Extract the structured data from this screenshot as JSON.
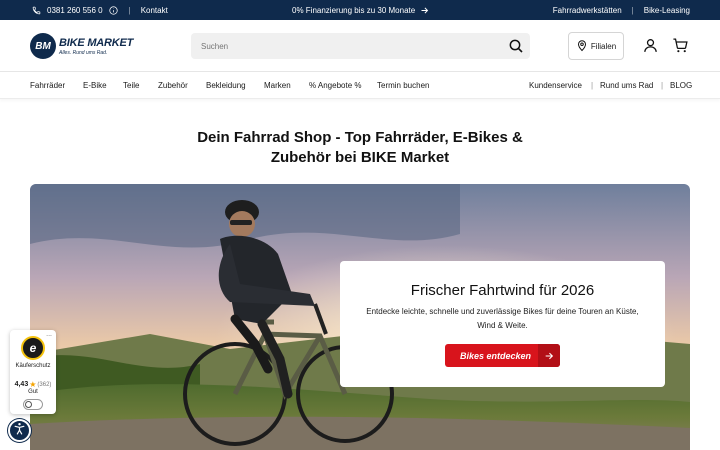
{
  "topbar": {
    "phone": "0381 260 556 0",
    "contact": "Kontakt",
    "financing": "0% Finanzierung bis zu 30 Monate",
    "workshops": "Fahrradwerkstätten",
    "leasing": "Bike-Leasing"
  },
  "header": {
    "logo_badge": "BM",
    "logo_name": "BIKE MARKET",
    "logo_tagline": "Alles. Rund ums Rad.",
    "search_placeholder": "Suchen",
    "stores_label": "Filialen"
  },
  "nav": {
    "items": [
      "Fahrräder",
      "E-Bike",
      "Teile",
      "Zubehör",
      "Bekleidung",
      "Marken",
      "% Angebote %",
      "Termin buchen"
    ],
    "right_items": [
      "Kundenservice",
      "Rund ums Rad",
      "BLOG"
    ]
  },
  "page": {
    "title_line1": "Dein Fahrrad Shop - Top Fahrräder, E-Bikes &",
    "title_line2": "Zubehör bei BIKE Market"
  },
  "hero": {
    "title": "Frischer Fahrtwind für 2026",
    "text": "Entdecke leichte, schnelle und zuverlässige Bikes für deine Touren an Küste, Wind & Weite.",
    "cta": "Bikes entdecken"
  },
  "trust_badge": {
    "seal": "e",
    "label": "Käuferschutz",
    "score": "4,43",
    "count": "(362)",
    "grade": "Gut",
    "menu": "..."
  },
  "colors": {
    "brand_navy": "#0f2a4c",
    "cta_red": "#d8141c"
  }
}
